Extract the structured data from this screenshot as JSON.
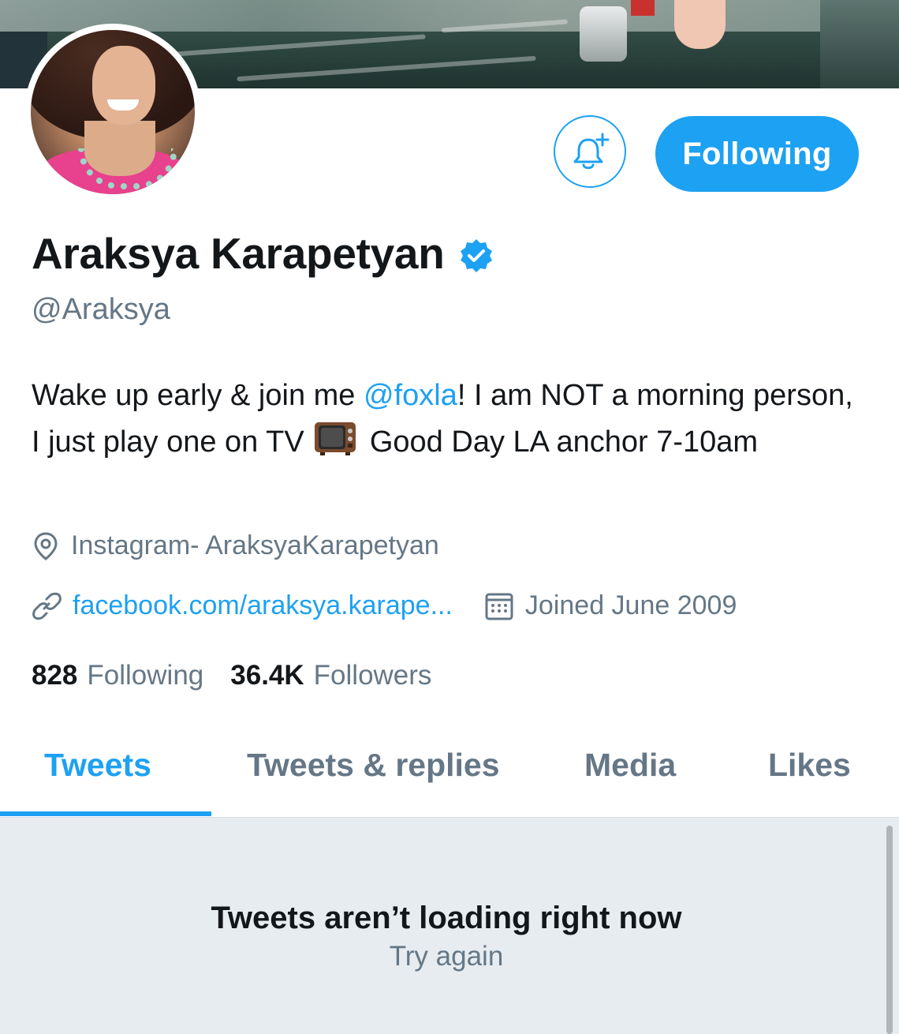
{
  "profile": {
    "name": "Araksya Karapetyan",
    "handle": "@Araksya",
    "bio": {
      "part1": "Wake up early & join me ",
      "mention": "@foxla",
      "part2": "! I am NOT a morning person, I just play one on TV ",
      "part3": " Good Day LA anchor 7-10am"
    },
    "location": "Instagram- AraksyaKarapetyan",
    "website": "facebook.com/araksya.karape...",
    "joined": "Joined June 2009"
  },
  "actions": {
    "follow_label": "Following",
    "notify_icon": "bell-plus-icon"
  },
  "stats": {
    "following_count": "828",
    "following_label": "Following",
    "followers_count": "36.4K",
    "followers_label": "Followers"
  },
  "tabs": [
    {
      "label": "Tweets",
      "active": true
    },
    {
      "label": "Tweets & replies",
      "active": false
    },
    {
      "label": "Media",
      "active": false
    },
    {
      "label": "Likes",
      "active": false
    }
  ],
  "timeline": {
    "error_title": "Tweets aren’t loading right now",
    "retry_label": "Try again"
  },
  "colors": {
    "accent": "#1da1f2",
    "secondary_text": "#657786",
    "timeline_bg": "#e6ecf0"
  }
}
